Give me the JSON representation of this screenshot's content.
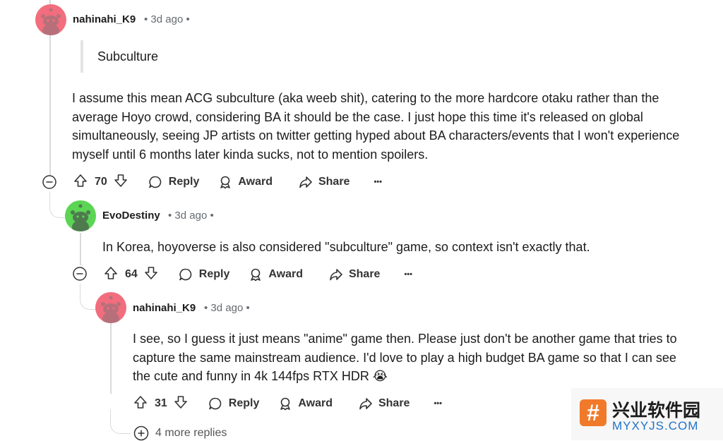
{
  "colors": {
    "avatar_pink": "#f26d7d",
    "avatar_green": "#5bd553",
    "thread_line": "#d7dadc",
    "watermark_orange": "#f07a2a",
    "watermark_blue": "#1e73c8"
  },
  "comments": [
    {
      "author": "nahinahi_K9",
      "meta": "• 3d ago •",
      "quote": "Subculture",
      "body": [
        "I assume this mean ACG subculture (aka weeb shit), catering to the more hardcore otaku rather than the",
        "average Hoyo crowd, considering BA it should be the case. I just hope this time it's released on global",
        "simultaneously, seeing JP artists on twitter getting hyped about BA characters/events that I won't experience",
        "myself until 6 months later kinda sucks, not to mention spoilers."
      ],
      "votes": "70",
      "reply": "Reply",
      "award": "Award",
      "share": "Share",
      "more": "•••"
    },
    {
      "author": "EvoDestiny",
      "meta": "• 3d ago •",
      "body": [
        "In Korea, hoyoverse is also considered \"subculture\" game, so context isn't exactly that."
      ],
      "votes": "64",
      "reply": "Reply",
      "award": "Award",
      "share": "Share",
      "more": "•••"
    },
    {
      "author": "nahinahi_K9",
      "meta": "• 3d ago •",
      "body": [
        "I see, so I guess it just means \"anime\" game then. Please just don't be another game that tries to",
        "capture the same mainstream audience. I'd love to play a high budget BA game so that I can see",
        "the cute and funny in 4k 144fps RTX HDR 😭"
      ],
      "votes": "31",
      "reply": "Reply",
      "award": "Award",
      "share": "Share",
      "more": "•••"
    }
  ],
  "more_replies": "4 more replies",
  "watermark": {
    "logo_char": "#",
    "title": "兴业软件园",
    "domain": "MYXYJS.COM"
  }
}
